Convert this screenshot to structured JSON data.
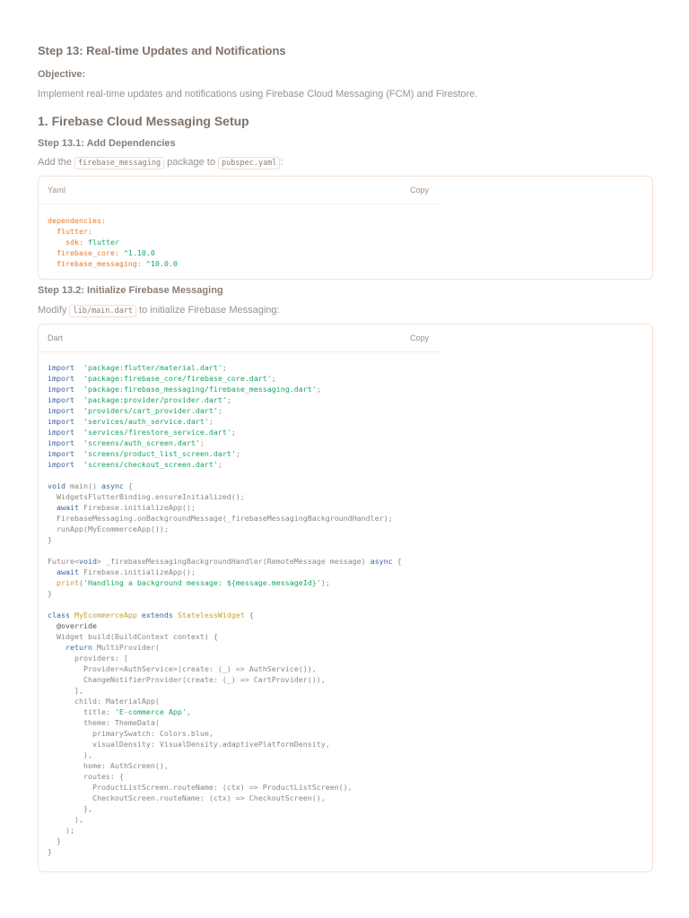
{
  "title": "Step 13: Real-time Updates and Notifications",
  "objective_label": "Objective:",
  "objective_text": "Implement real-time updates and notifications using Firebase Cloud Messaging (FCM) and Firestore.",
  "section1": "1. Firebase Cloud Messaging Setup",
  "step1": {
    "heading": "Step 13.1: Add Dependencies",
    "pre": "Add the ",
    "code1": "firebase_messaging",
    "mid": " package to ",
    "code2": "pubspec.yaml",
    "post": ":"
  },
  "yaml_block": {
    "lang": "Yaml",
    "copy": "Copy",
    "lines": [
      [
        [
          "orn",
          "dependencies:"
        ]
      ],
      [
        [
          "orn",
          "  flutter:"
        ]
      ],
      [
        [
          "orn",
          "    sdk: "
        ],
        [
          "str",
          "flutter"
        ]
      ],
      [
        [
          "orn",
          "  firebase_core: "
        ],
        [
          "str",
          "^1.10.0"
        ]
      ],
      [
        [
          "orn",
          "  firebase_messaging: "
        ],
        [
          "str",
          "^10.0.0"
        ]
      ]
    ]
  },
  "step2": {
    "heading": "Step 13.2: Initialize Firebase Messaging",
    "pre": "Modify ",
    "code1": "lib/main.dart",
    "post": " to initialize Firebase Messaging:"
  },
  "dart_block": {
    "lang": "Dart",
    "copy": "Copy",
    "lines": [
      [
        [
          "kw",
          "import"
        ],
        [
          "",
          "  "
        ],
        [
          "str",
          "'package:flutter/material.dart'"
        ],
        [
          "",
          ";"
        ]
      ],
      [
        [
          "kw",
          "import"
        ],
        [
          "",
          "  "
        ],
        [
          "str",
          "'package:firebase_core/firebase_core.dart'"
        ],
        [
          "",
          ";"
        ]
      ],
      [
        [
          "kw",
          "import"
        ],
        [
          "",
          "  "
        ],
        [
          "str",
          "'package:firebase_messaging/firebase_messaging.dart'"
        ],
        [
          "",
          ";"
        ]
      ],
      [
        [
          "kw",
          "import"
        ],
        [
          "",
          "  "
        ],
        [
          "str",
          "'package:provider/provider.dart'"
        ],
        [
          "",
          ";"
        ]
      ],
      [
        [
          "kw",
          "import"
        ],
        [
          "",
          "  "
        ],
        [
          "str",
          "'providers/cart_provider.dart'"
        ],
        [
          "",
          ";"
        ]
      ],
      [
        [
          "kw",
          "import"
        ],
        [
          "",
          "  "
        ],
        [
          "str",
          "'services/auth_service.dart'"
        ],
        [
          "",
          ";"
        ]
      ],
      [
        [
          "kw",
          "import"
        ],
        [
          "",
          "  "
        ],
        [
          "str",
          "'services/firestore_service.dart'"
        ],
        [
          "",
          ";"
        ]
      ],
      [
        [
          "kw",
          "import"
        ],
        [
          "",
          "  "
        ],
        [
          "str",
          "'screens/auth_screen.dart'"
        ],
        [
          "",
          ";"
        ]
      ],
      [
        [
          "kw",
          "import"
        ],
        [
          "",
          "  "
        ],
        [
          "str",
          "'screens/product_list_screen.dart'"
        ],
        [
          "",
          ";"
        ]
      ],
      [
        [
          "kw",
          "import"
        ],
        [
          "",
          "  "
        ],
        [
          "str",
          "'screens/checkout_screen.dart'"
        ],
        [
          "",
          ";"
        ]
      ],
      [
        [
          "",
          ""
        ]
      ],
      [
        [
          "kw",
          "void"
        ],
        [
          "",
          " main() "
        ],
        [
          "kw",
          "async"
        ],
        [
          "",
          " {"
        ]
      ],
      [
        [
          "",
          "  WidgetsFlutterBinding.ensureInitialized();"
        ]
      ],
      [
        [
          "kw",
          "  await"
        ],
        [
          "",
          " Firebase.initializeApp();"
        ]
      ],
      [
        [
          "",
          "  FirebaseMessaging.onBackgroundMessage(_firebaseMessagingBackgroundHandler);"
        ]
      ],
      [
        [
          "",
          "  runApp(MyEcommerceApp());"
        ]
      ],
      [
        [
          "",
          "}"
        ]
      ],
      [
        [
          "",
          ""
        ]
      ],
      [
        [
          "",
          "Future<"
        ],
        [
          "kw",
          "void"
        ],
        [
          "",
          "> _firebaseMessagingBackgroundHandler(RemoteMessage message) "
        ],
        [
          "kw",
          "async"
        ],
        [
          "",
          " {"
        ]
      ],
      [
        [
          "kw",
          "  await"
        ],
        [
          "",
          " Firebase.initializeApp();"
        ]
      ],
      [
        [
          "cls",
          "  print"
        ],
        [
          "",
          "("
        ],
        [
          "str",
          "'Handling a background message: ${message.messageId}'"
        ],
        [
          "",
          ");"
        ]
      ],
      [
        [
          "",
          "}"
        ]
      ],
      [
        [
          "",
          ""
        ]
      ],
      [
        [
          "kw",
          "class"
        ],
        [
          "",
          " "
        ],
        [
          "cls",
          "MyEcommerceApp"
        ],
        [
          "",
          " "
        ],
        [
          "kw",
          "extends"
        ],
        [
          "",
          " "
        ],
        [
          "cls",
          "StatelessWidget"
        ],
        [
          "",
          " {"
        ]
      ],
      [
        [
          "ann",
          "  @override"
        ]
      ],
      [
        [
          "",
          "  Widget build(BuildContext context) {"
        ]
      ],
      [
        [
          "kw",
          "    return"
        ],
        [
          "",
          " MultiProvider("
        ]
      ],
      [
        [
          "",
          "      providers: ["
        ]
      ],
      [
        [
          "",
          "        Provider<AuthService>(create: (_) => AuthService()),"
        ]
      ],
      [
        [
          "",
          "        ChangeNotifierProvider(create: (_) => CartProvider()),"
        ]
      ],
      [
        [
          "",
          "      ],"
        ]
      ],
      [
        [
          "",
          "      child: MaterialApp("
        ]
      ],
      [
        [
          "",
          "        title: "
        ],
        [
          "str",
          "'E-commerce App'"
        ],
        [
          "",
          ","
        ]
      ],
      [
        [
          "",
          "        theme: ThemeData("
        ]
      ],
      [
        [
          "",
          "          primarySwatch: Colors.blue,"
        ]
      ],
      [
        [
          "",
          "          visualDensity: VisualDensity.adaptivePlatformDensity,"
        ]
      ],
      [
        [
          "",
          "        ),"
        ]
      ],
      [
        [
          "",
          "        home: AuthScreen(),"
        ]
      ],
      [
        [
          "",
          "        routes: {"
        ]
      ],
      [
        [
          "",
          "          ProductListScreen.routeName: (ctx) => ProductListScreen(),"
        ]
      ],
      [
        [
          "",
          "          CheckoutScreen.routeName: (ctx) => CheckoutScreen(),"
        ]
      ],
      [
        [
          "",
          "        },"
        ]
      ],
      [
        [
          "",
          "      ),"
        ]
      ],
      [
        [
          "",
          "    );"
        ]
      ],
      [
        [
          "",
          "  }"
        ]
      ],
      [
        [
          "",
          "}"
        ]
      ]
    ]
  }
}
